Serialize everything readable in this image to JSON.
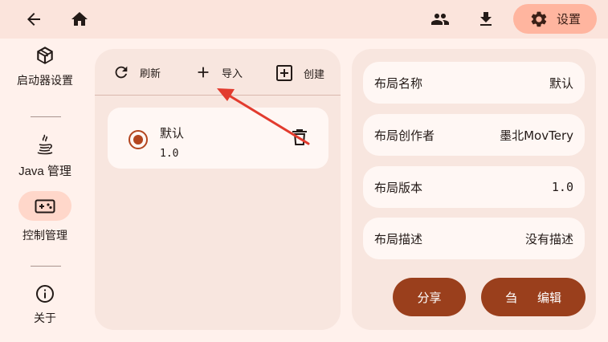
{
  "topbar": {
    "back_icon": "arrow-back-icon",
    "home_icon": "home-icon",
    "people_icon": "people-icon",
    "download_icon": "download-icon",
    "settings_label": "设置"
  },
  "sidebar": {
    "items": [
      {
        "label": "启动器设置",
        "icon": "cube-icon"
      },
      {
        "label": "Java 管理",
        "icon": "java-icon"
      },
      {
        "label": "控制管理",
        "icon": "gamepad-icon",
        "selected": true
      },
      {
        "label": "关于",
        "icon": "info-icon"
      }
    ]
  },
  "toolbar": {
    "refresh_label": "刷新",
    "import_label": "导入",
    "create_label": "创建"
  },
  "layouts": [
    {
      "name": "默认",
      "version": "1.0",
      "selected": true
    }
  ],
  "details": {
    "rows": [
      {
        "label": "布局名称",
        "value": "默认"
      },
      {
        "label": "布局创作者",
        "value": "墨北MovTery"
      },
      {
        "label": "布局版本",
        "value": "1.0"
      },
      {
        "label": "布局描述",
        "value": "没有描述"
      }
    ],
    "share_label": "分享",
    "edit_icon_glyph": "刍",
    "edit_label": "编辑"
  },
  "colors": {
    "accent": "#9a3f1c",
    "topbar": "#fbe4dc",
    "background": "#fff1ec",
    "panel": "#f8e6df",
    "annotation_arrow": "#e23b2e"
  }
}
